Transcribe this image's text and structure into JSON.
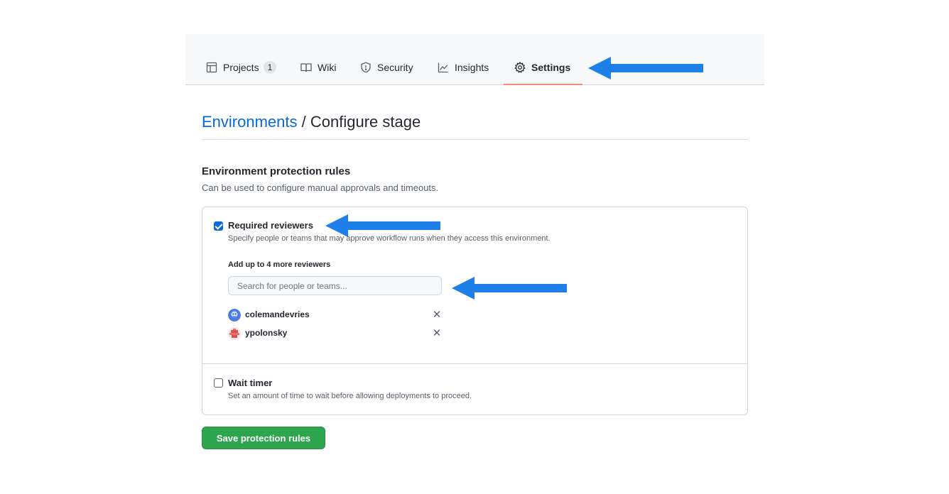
{
  "tabs": {
    "projects": {
      "label": "Projects",
      "count": "1",
      "icon": "table-icon"
    },
    "wiki": {
      "label": "Wiki",
      "icon": "book-icon"
    },
    "security": {
      "label": "Security",
      "icon": "shield-icon"
    },
    "insights": {
      "label": "Insights",
      "icon": "graph-icon"
    },
    "settings": {
      "label": "Settings",
      "icon": "gear-icon",
      "active": true
    }
  },
  "breadcrumb": {
    "link": "Environments",
    "separator": " / ",
    "current": "Configure stage"
  },
  "protection": {
    "title": "Environment protection rules",
    "subtitle": "Can be used to configure manual approvals and timeouts."
  },
  "required_reviewers": {
    "checked": true,
    "label": "Required reviewers",
    "description": "Specify people or teams that may approve workflow runs when they access this environment.",
    "add_label": "Add up to 4 more reviewers",
    "search_placeholder": "Search for people or teams...",
    "reviewers": [
      {
        "name": "colemandevries",
        "remove": "✕"
      },
      {
        "name": "ypolonsky",
        "remove": "✕"
      }
    ]
  },
  "wait_timer": {
    "checked": false,
    "label": "Wait timer",
    "description": "Set an amount of time to wait before allowing deployments to proceed."
  },
  "save_button": {
    "label": "Save protection rules"
  },
  "colors": {
    "accent_link": "#0969da",
    "primary_button": "#2da44e",
    "annotation_arrow": "#1f7fe8",
    "active_tab_underline": "#fd8c73"
  }
}
